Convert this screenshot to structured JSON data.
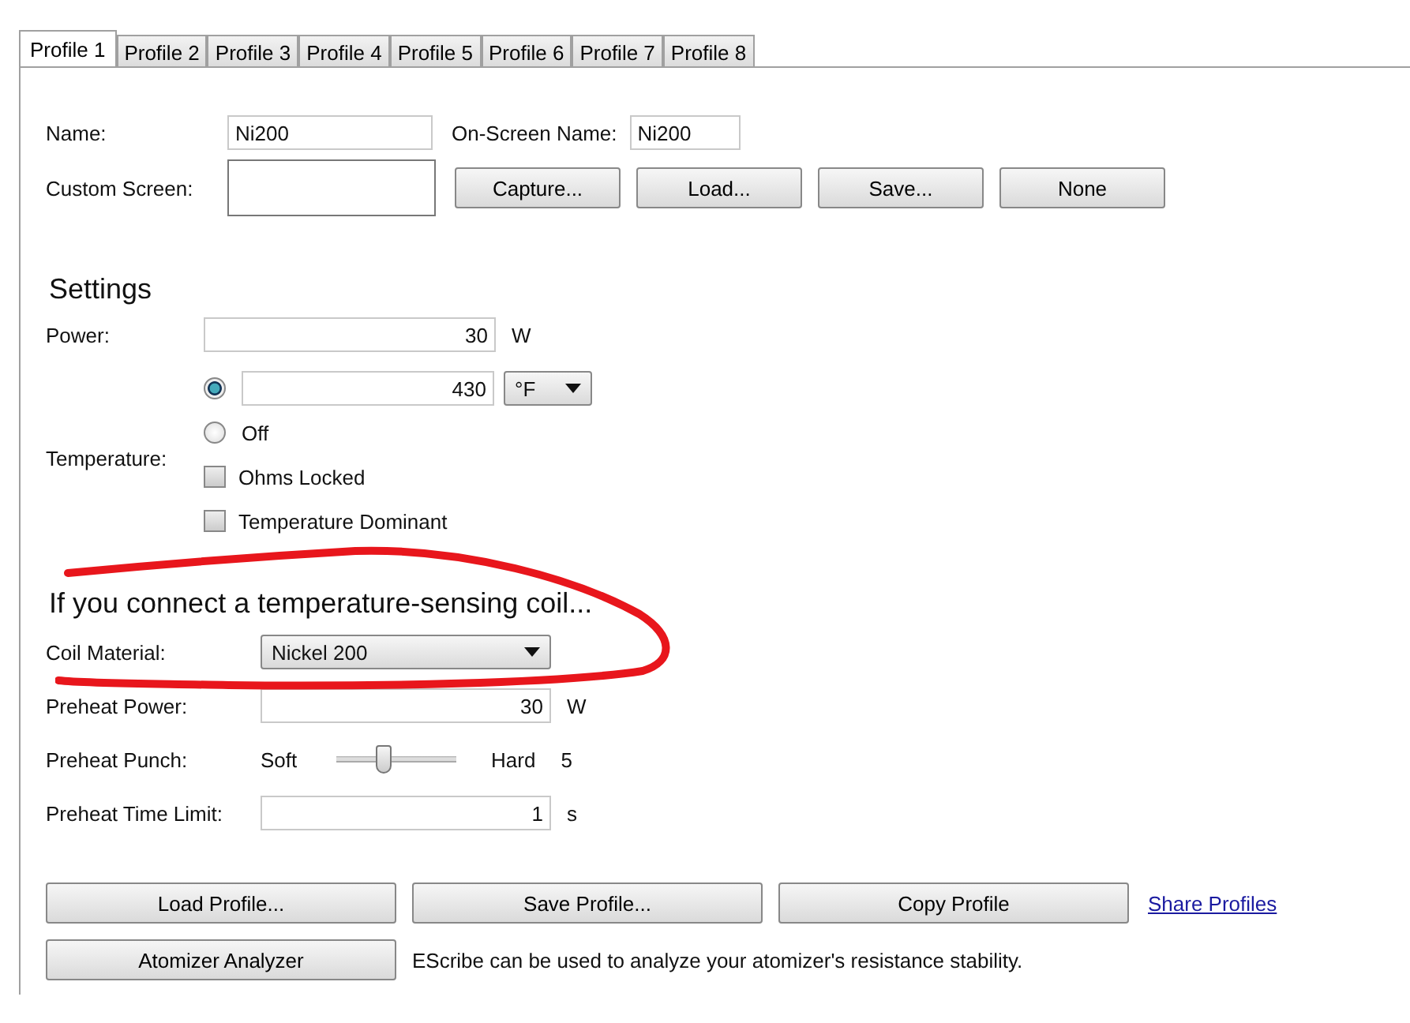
{
  "tabs": [
    {
      "label": "Profile 1",
      "selected": true
    },
    {
      "label": "Profile 2",
      "selected": false
    },
    {
      "label": "Profile 3",
      "selected": false
    },
    {
      "label": "Profile 4",
      "selected": false
    },
    {
      "label": "Profile 5",
      "selected": false
    },
    {
      "label": "Profile 6",
      "selected": false
    },
    {
      "label": "Profile 7",
      "selected": false
    },
    {
      "label": "Profile 8",
      "selected": false
    }
  ],
  "name": {
    "label": "Name:",
    "value": "Ni200"
  },
  "on_screen_name": {
    "label": "On-Screen Name:",
    "value": "Ni200"
  },
  "custom_screen": {
    "label": "Custom Screen:",
    "buttons": [
      "Capture...",
      "Load...",
      "Save...",
      "None"
    ]
  },
  "settings": {
    "heading": "Settings",
    "power": {
      "label": "Power:",
      "value": "30",
      "unit": "W"
    },
    "temperature": {
      "label": "Temperature:",
      "options": [
        {
          "kind": "value",
          "selected": true,
          "value": "430",
          "unit": "°F"
        },
        {
          "kind": "off",
          "selected": false,
          "label": "Off"
        }
      ]
    },
    "checkboxes": [
      {
        "label": "Ohms Locked",
        "checked": false
      },
      {
        "label": "Temperature Dominant",
        "checked": false
      }
    ]
  },
  "coil_section": {
    "heading": "If you connect a temperature-sensing coil...",
    "coil_material": {
      "label": "Coil Material:",
      "value": "Nickel 200"
    },
    "preheat_power": {
      "label": "Preheat Power:",
      "value": "30",
      "unit": "W"
    },
    "preheat_punch": {
      "label": "Preheat Punch:",
      "min_label": "Soft",
      "max_label": "Hard",
      "level": 0.4,
      "reading": "5"
    },
    "preheat_time_limit": {
      "label": "Preheat Time Limit:",
      "value": "1",
      "unit": "s"
    }
  },
  "buttons": [
    "Load Profile...",
    "Save Profile...",
    "Copy Profile"
  ],
  "share_link": "Share Profiles",
  "analyzer": {
    "button": "Atomizer Analyzer",
    "description": "EScribe can be used to analyze your atomizer's resistance stability."
  }
}
